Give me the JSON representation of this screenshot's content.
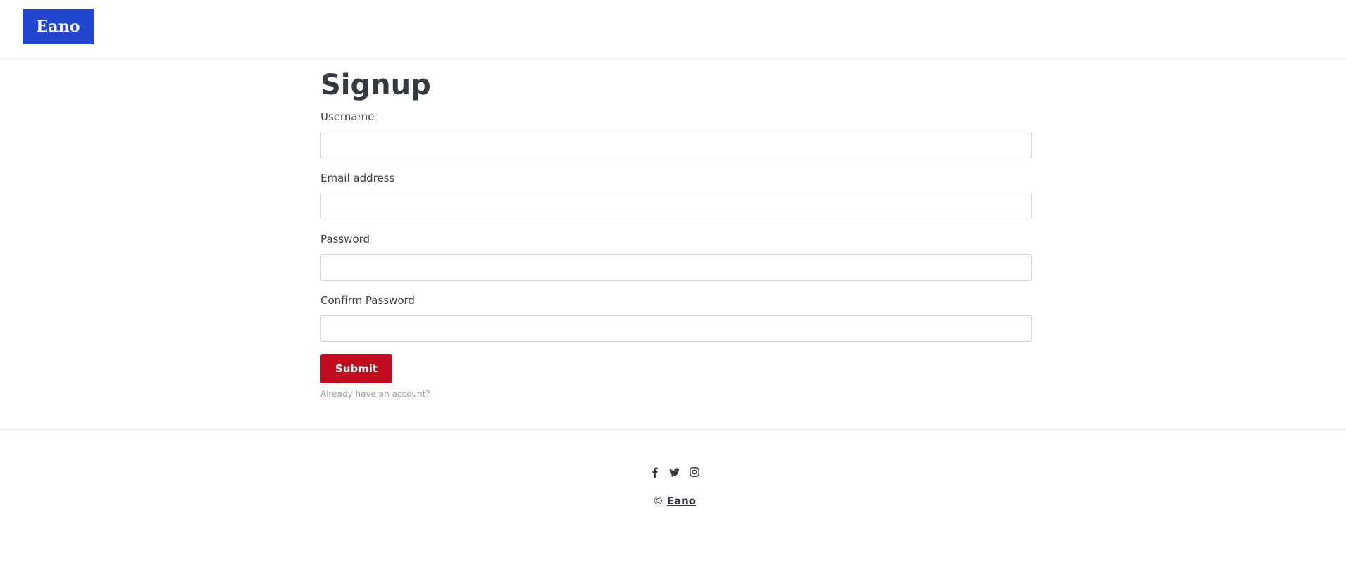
{
  "header": {
    "logo_text": "Eano",
    "logo_color": "#2346d1"
  },
  "main": {
    "title": "Signup",
    "fields": [
      {
        "label": "Username",
        "value": "",
        "placeholder": ""
      },
      {
        "label": "Email address",
        "value": "",
        "placeholder": ""
      },
      {
        "label": "Password",
        "value": "",
        "placeholder": ""
      },
      {
        "label": "Confirm Password",
        "value": "",
        "placeholder": ""
      }
    ],
    "submit_label": "Submit",
    "submit_color": "#c00c1e",
    "login_link_text": "Already have an account?"
  },
  "footer": {
    "social_icons": [
      "facebook-icon",
      "twitter-icon",
      "instagram-icon"
    ],
    "copyright_symbol": "©",
    "copyright_brand": "Eano"
  }
}
